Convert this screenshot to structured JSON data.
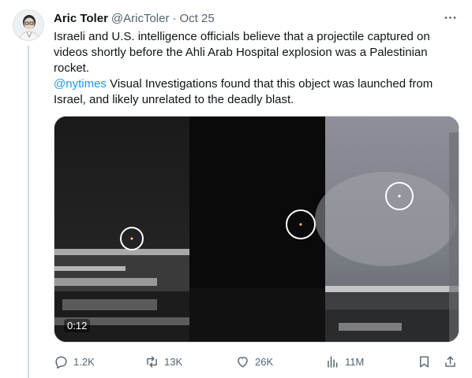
{
  "tweet": {
    "author_name": "Aric Toler",
    "handle": "@AricToler",
    "separator": "·",
    "timestamp": "Oct 25",
    "text_line1": "Israeli and U.S. intelligence officials believe that a projectile captured on videos shortly before the Ahli Arab Hospital explosion was a Palestinian rocket.",
    "mention": "@nytimes",
    "text_line2": " Visual Investigations found that this object was launched from Israel, and likely unrelated to the deadly blast."
  },
  "media": {
    "duration": "0:12"
  },
  "actions": {
    "replies": "1.2K",
    "reposts": "13K",
    "likes": "26K",
    "views": "11M"
  },
  "colors": {
    "accent": "#1d9bf0",
    "muted": "#536471",
    "border": "#cfd9de"
  },
  "icons": [
    "more-icon",
    "reply-icon",
    "repost-icon",
    "like-icon",
    "views-icon",
    "bookmark-icon",
    "share-icon"
  ]
}
